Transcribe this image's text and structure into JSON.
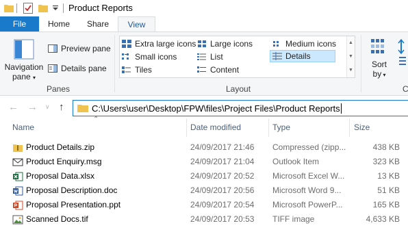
{
  "window": {
    "title": "Product Reports"
  },
  "ribbon": {
    "tabs": [
      {
        "label": "File",
        "active": false
      },
      {
        "label": "Home",
        "active": false
      },
      {
        "label": "Share",
        "active": false
      },
      {
        "label": "View",
        "active": true
      }
    ],
    "panes": {
      "group_label": "Panes",
      "navigation_pane_line1": "Navigation",
      "navigation_pane_line2": "pane",
      "preview_pane": "Preview pane",
      "details_pane": "Details pane"
    },
    "layout": {
      "group_label": "Layout",
      "items": [
        {
          "label": "Extra large icons",
          "icon": "extra-large-icons-icon"
        },
        {
          "label": "Large icons",
          "icon": "large-icons-icon"
        },
        {
          "label": "Medium icons",
          "icon": "medium-icons-icon"
        },
        {
          "label": "Small icons",
          "icon": "small-icons-icon"
        },
        {
          "label": "List",
          "icon": "list-icon"
        },
        {
          "label": "Details",
          "icon": "details-icon",
          "selected": true
        },
        {
          "label": "Tiles",
          "icon": "tiles-icon"
        },
        {
          "label": "Content",
          "icon": "content-icon"
        }
      ]
    },
    "current_view": {
      "sort_by_line1": "Sort",
      "sort_by_line2": "by",
      "group_label_partial": "C"
    }
  },
  "address": {
    "path": "C:\\Users\\user\\Desktop\\FPW\\files\\Project Files\\Product Reports"
  },
  "file_list": {
    "columns": [
      "Name",
      "Date modified",
      "Type",
      "Size"
    ],
    "sort_column": "Name",
    "rows": [
      {
        "name": "Product Details.zip",
        "date": "24/09/2017 21:46",
        "type": "Compressed (zipp...",
        "size": "438 KB",
        "icon": "zip-folder-icon"
      },
      {
        "name": "Product Enquiry.msg",
        "date": "24/09/2017 21:04",
        "type": "Outlook Item",
        "size": "323 KB",
        "icon": "envelope-icon"
      },
      {
        "name": "Proposal Data.xlsx",
        "date": "24/09/2017 20:52",
        "type": "Microsoft Excel W...",
        "size": "13 KB",
        "icon": "excel-icon"
      },
      {
        "name": "Proposal Description.doc",
        "date": "24/09/2017 20:56",
        "type": "Microsoft Word 9...",
        "size": "51 KB",
        "icon": "word-icon"
      },
      {
        "name": "Proposal Presentation.ppt",
        "date": "24/09/2017 20:54",
        "type": "Microsoft PowerP...",
        "size": "165 KB",
        "icon": "powerpoint-icon"
      },
      {
        "name": "Scanned Docs.tif",
        "date": "24/09/2017 20:53",
        "type": "TIFF image",
        "size": "4,633 KB",
        "icon": "image-icon"
      }
    ]
  },
  "colors": {
    "accent": "#1979ca",
    "selected_bg": "#cce8ff",
    "header_text": "#4c607a",
    "excel": "#1d6f42",
    "word": "#2b579a",
    "powerpoint": "#d24726",
    "folder": "#f0c24f"
  }
}
